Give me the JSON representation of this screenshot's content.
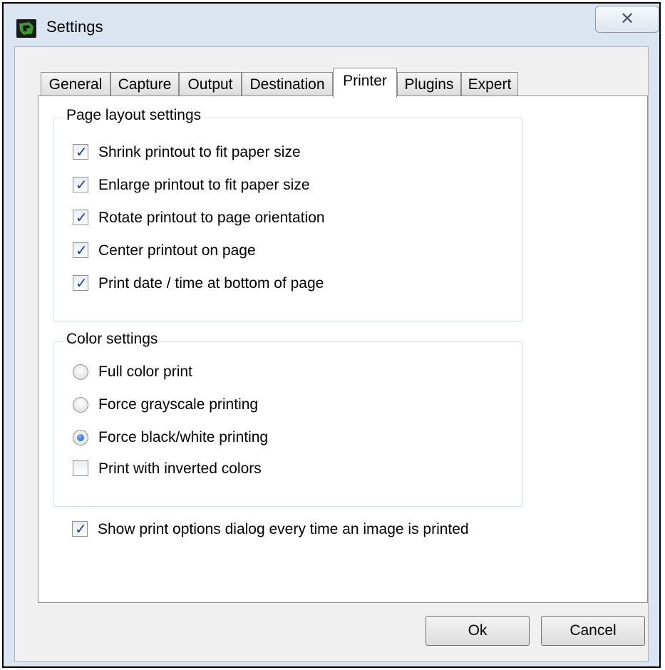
{
  "window": {
    "title": "Settings",
    "close_glyph": "✕"
  },
  "tabs": [
    {
      "label": "General",
      "active": false
    },
    {
      "label": "Capture",
      "active": false
    },
    {
      "label": "Output",
      "active": false
    },
    {
      "label": "Destination",
      "active": false
    },
    {
      "label": "Printer",
      "active": true
    },
    {
      "label": "Plugins",
      "active": false
    },
    {
      "label": "Expert",
      "active": false
    }
  ],
  "page_layout": {
    "title": "Page layout settings",
    "options": [
      {
        "label": "Shrink printout to fit paper size",
        "checked": true
      },
      {
        "label": "Enlarge printout to fit paper size",
        "checked": true
      },
      {
        "label": "Rotate printout to page orientation",
        "checked": true
      },
      {
        "label": "Center printout on page",
        "checked": true
      },
      {
        "label": "Print date / time at bottom of page",
        "checked": true
      }
    ]
  },
  "color_settings": {
    "title": "Color settings",
    "radios": [
      {
        "label": "Full color print",
        "selected": false
      },
      {
        "label": "Force grayscale printing",
        "selected": false
      },
      {
        "label": "Force black/white printing",
        "selected": true
      }
    ],
    "invert": {
      "label": "Print with inverted colors",
      "checked": false
    }
  },
  "show_dialog": {
    "label": "Show print options dialog every time an image is printed",
    "checked": true
  },
  "buttons": {
    "ok": "Ok",
    "cancel": "Cancel"
  },
  "colors": {
    "window_frame": "#dbe5f1",
    "client": "#f0f0f0",
    "check_mark": "#1f3a8a"
  },
  "icons": {
    "app": "greenshot-app-icon",
    "close": "close-icon"
  }
}
